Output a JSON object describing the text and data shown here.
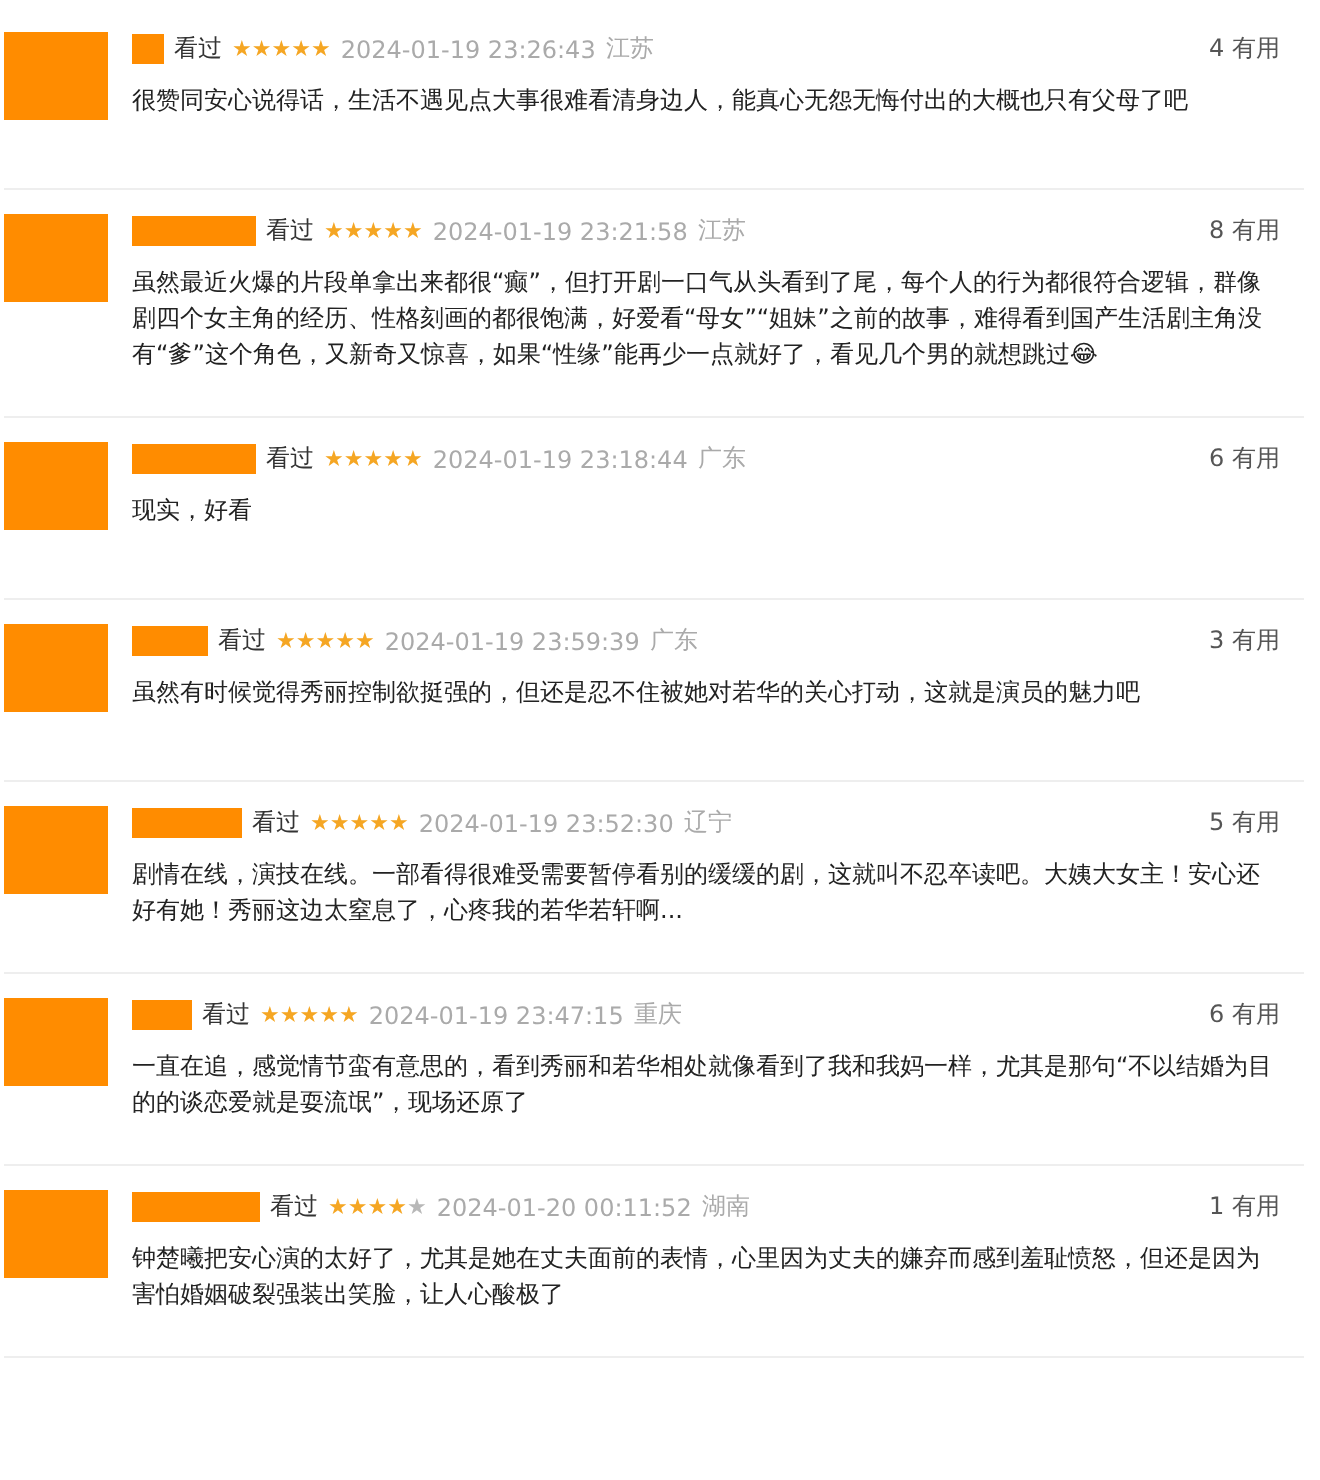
{
  "reviews": [
    {
      "status": "看过",
      "stars": 5,
      "time": "2024-01-19 23:26:43",
      "location": "江苏",
      "useful": "4 有用",
      "text": "很赞同安心说得话，生活不遇见点大事很难看清身边人，能真心无怨无悔付出的大概也只有父母了吧"
    },
    {
      "status": "看过",
      "stars": 5,
      "time": "2024-01-19 23:21:58",
      "location": "江苏",
      "useful": "8 有用",
      "text": "虽然最近火爆的片段单拿出来都很“癫”，但打开剧一口气从头看到了尾，每个人的行为都很符合逻辑，群像剧四个女主角的经历、性格刻画的都很饱满，好爱看“母女”“姐妹”之前的故事，难得看到国产生活剧主角没有“爹”这个角色，又新奇又惊喜，如果“性缘”能再少一点就好了，看见几个男的就想跳过😂"
    },
    {
      "status": "看过",
      "stars": 5,
      "time": "2024-01-19 23:18:44",
      "location": "广东",
      "useful": "6 有用",
      "text": "现实，好看"
    },
    {
      "status": "看过",
      "stars": 5,
      "time": "2024-01-19 23:59:39",
      "location": "广东",
      "useful": "3 有用",
      "text": "虽然有时候觉得秀丽控制欲挺强的，但还是忍不住被她对若华的关心打动，这就是演员的魅力吧"
    },
    {
      "status": "看过",
      "stars": 5,
      "time": "2024-01-19 23:52:30",
      "location": "辽宁",
      "useful": "5 有用",
      "text": "剧情在线，演技在线。一部看得很难受需要暂停看别的缓缓的剧，这就叫不忍卒读吧。大姨大女主！安心还好有她！秀丽这边太窒息了，心疼我的若华若轩啊..."
    },
    {
      "status": "看过",
      "stars": 5,
      "time": "2024-01-19 23:47:15",
      "location": "重庆",
      "useful": "6 有用",
      "text": "一直在追，感觉情节蛮有意思的，看到秀丽和若华相处就像看到了我和我妈一样，尤其是那句“不以结婚为目的的谈恋爱就是耍流氓”，现场还原了"
    },
    {
      "status": "看过",
      "stars": 4,
      "time": "2024-01-20 00:11:52",
      "location": "湖南",
      "useful": "1 有用",
      "text": "钟楚曦把安心演的太好了，尤其是她在丈夫面前的表情，心里因为丈夫的嫌弃而感到羞耻愤怒，但还是因为害怕婚姻破裂强装出笑脸，让人心酸极了"
    }
  ]
}
